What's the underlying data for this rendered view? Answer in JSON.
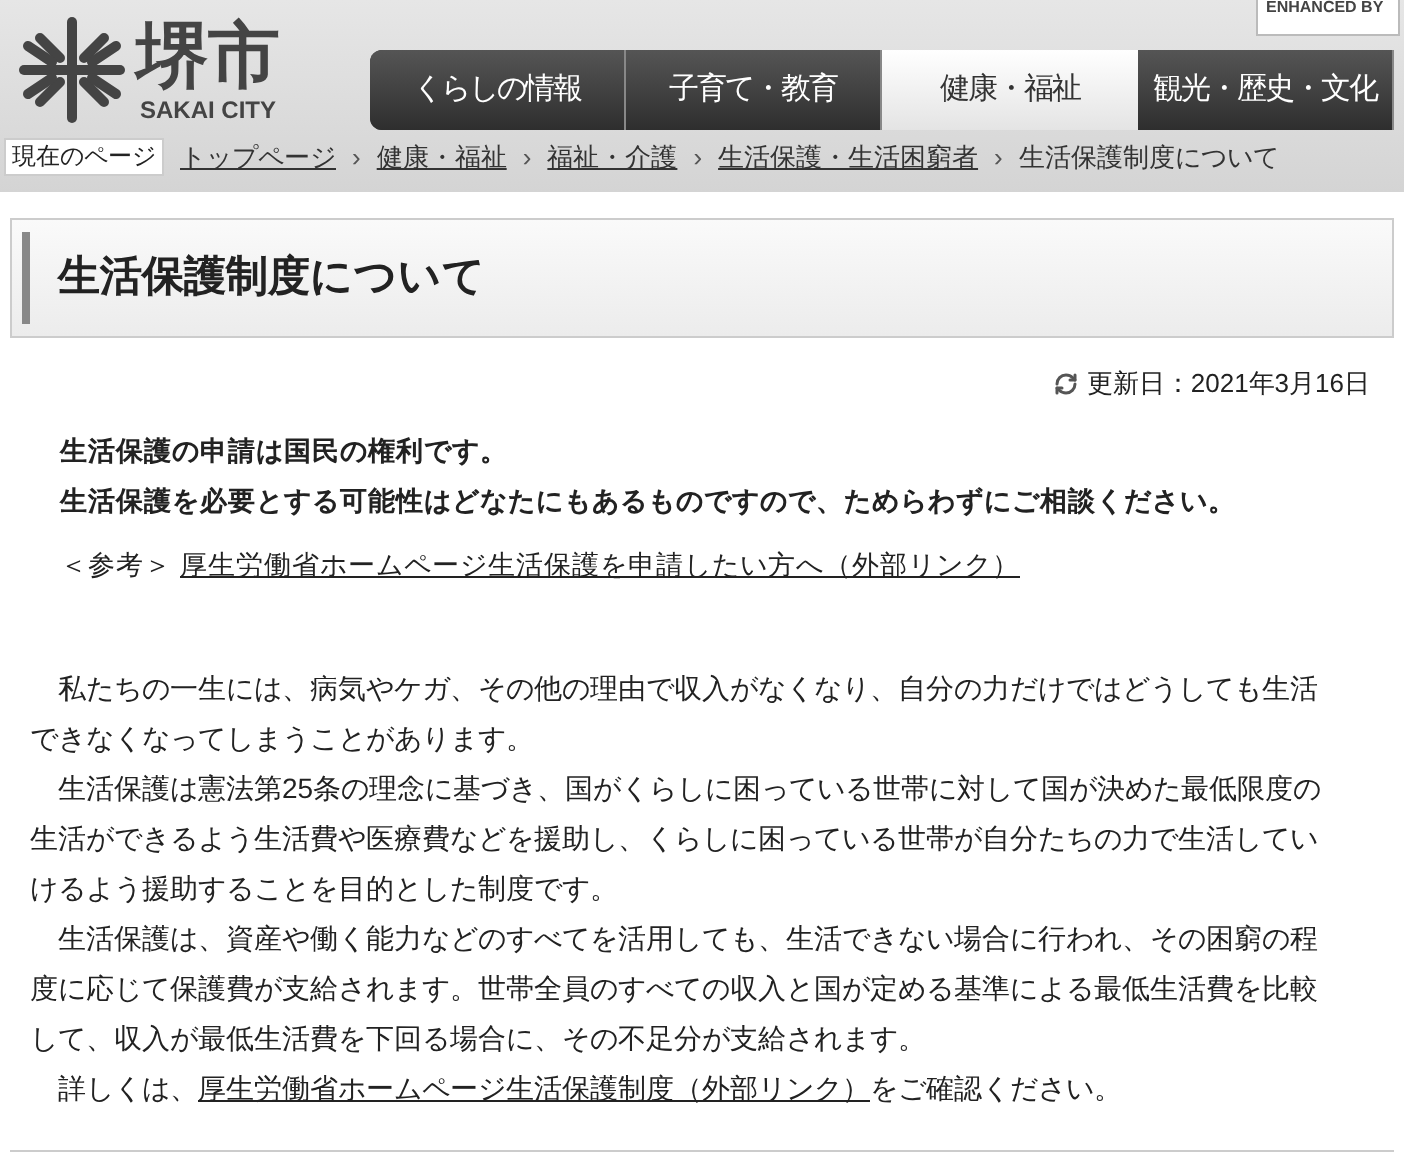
{
  "header": {
    "logo_kanji": "堺市",
    "logo_roman": "SAKAI CITY",
    "enhanced_label": "ENHANCED BY"
  },
  "nav_tabs": [
    {
      "label": "くらしの情報",
      "selected": false
    },
    {
      "label": "子育て・教育",
      "selected": false
    },
    {
      "label": "健康・福祉",
      "selected": true
    },
    {
      "label": "観光・歴史・文化",
      "selected": false
    }
  ],
  "breadcrumb": {
    "label": "現在のページ",
    "items": [
      {
        "text": "トップページ",
        "kind": "link"
      },
      {
        "text": "健康・福祉",
        "kind": "link"
      },
      {
        "text": "福祉・介護",
        "kind": "link"
      },
      {
        "text": "生活保護・生活困窮者",
        "kind": "link"
      },
      {
        "text": "生活保護制度について",
        "kind": "current"
      }
    ],
    "separator": "›"
  },
  "page_title": "生活保護制度について",
  "updated": "更新日：2021年3月16日",
  "lead": [
    "生活保護の申請は国民の権利です。",
    "生活保護を必要とする可能性はどなたにもあるものですので、ためらわずにご相談ください。"
  ],
  "reference": {
    "label": "＜参考＞",
    "link": "厚生労働省ホームページ生活保護を申請したい方へ（外部リンク）"
  },
  "paragraphs": [
    {
      "text": "私たちの一生には、病気やケガ、その他の理由で収入がなくなり、自分の力だけではどうしても生活できなくなってしまうことがあります。"
    },
    {
      "text": "生活保護は憲法第25条の理念に基づき、国がくらしに困っている世帯に対して国が決めた最低限度の生活ができるよう生活費や医療費などを援助し、くらしに困っている世帯が自分たちの力で生活していけるよう援助することを目的とした制度です。"
    },
    {
      "text": "生活保護は、資産や働く能力などのすべてを活用しても、生活できない場合に行われ、その困窮の程度に応じて保護費が支給されます。世帯全員のすべての収入と国が定める基準による最低生活費を比較して、収入が最低生活費を下回る場合に、その不足分が支給されます。"
    },
    {
      "text": "詳しくは、",
      "link": "厚生労働省ホームページ生活保護制度（外部リンク）",
      "after": "をご確認ください。"
    }
  ]
}
